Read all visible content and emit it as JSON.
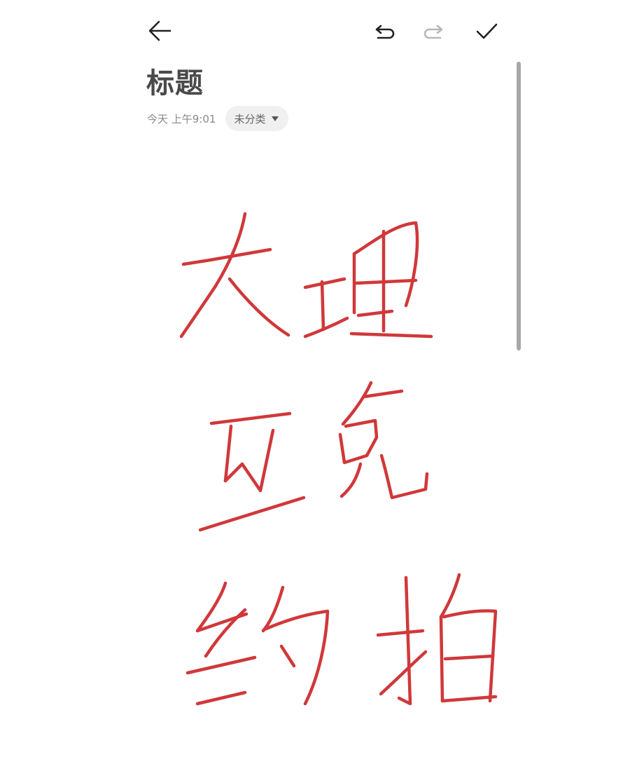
{
  "toolbar": {
    "back_icon": "arrow-left-icon",
    "undo_icon": "undo-icon",
    "redo_icon": "redo-icon",
    "done_icon": "check-icon"
  },
  "note": {
    "title": "标题",
    "timestamp": "今天 上午9:01",
    "category": "未分类"
  },
  "handwriting": {
    "lines": [
      "大理",
      "互免",
      "约拍"
    ],
    "ink_color": "#d0383a"
  },
  "colors": {
    "icon_active": "#222222",
    "icon_disabled": "#b8b8b8",
    "title": "#4a4a4a",
    "chip_bg": "#f0f0f0"
  }
}
